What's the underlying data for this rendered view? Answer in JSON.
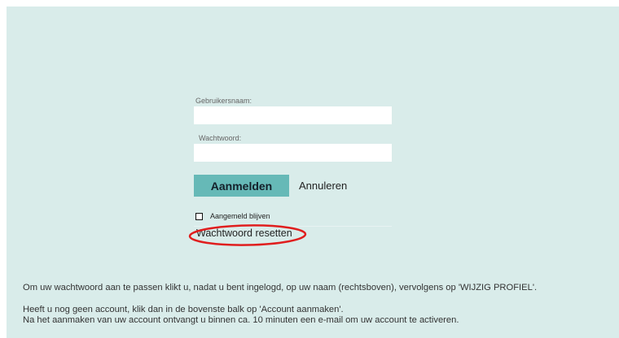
{
  "login": {
    "username_label": "Gebruikersnaam:",
    "username_value": "",
    "password_label": "Wachtwoord:",
    "password_value": "",
    "login_button": "Aanmelden",
    "cancel_link": "Annuleren",
    "remember_label": "Aangemeld blijven",
    "remember_checked": false,
    "reset_link": "Wachtwoord resetten"
  },
  "annotation": {
    "color": "#e01e1e"
  },
  "colors": {
    "panel_bg": "#d9ecea",
    "button_bg": "#66b9b7"
  },
  "info": {
    "line1": "Om uw wachtwoord aan te passen klikt u, nadat u bent ingelogd, op uw naam (rechtsboven), vervolgens op 'WIJZIG PROFIEL'.",
    "line2": "Heeft u nog geen account, klik dan in de bovenste balk op 'Account aanmaken'.",
    "line3": "Na het aanmaken van uw account ontvangt u binnen ca. 10 minuten een e-mail om uw account te activeren."
  }
}
